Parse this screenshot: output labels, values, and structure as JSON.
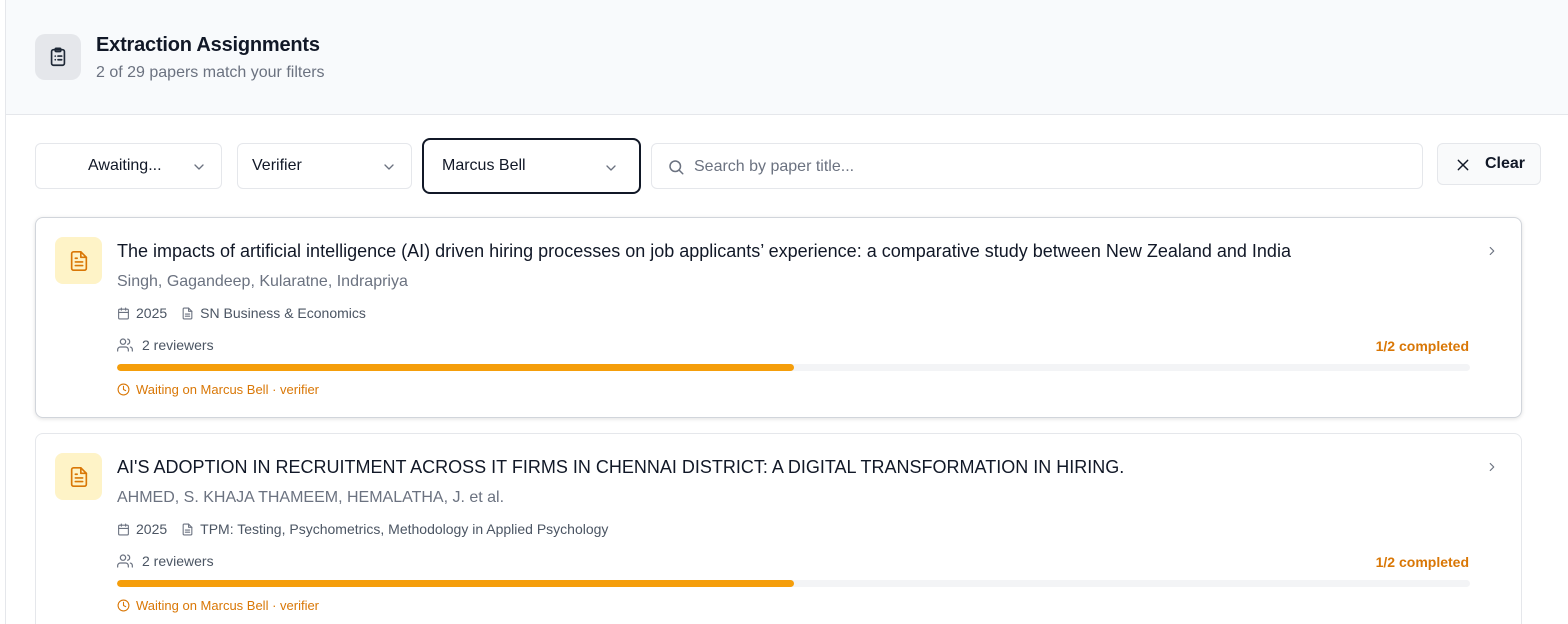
{
  "header": {
    "title": "Extraction Assignments",
    "subtitle": "2 of 29 papers match your filters",
    "icon": "clipboard-list-icon"
  },
  "filters": {
    "status_value": "Awaiting...",
    "role_value": "Verifier",
    "person_value": "Marcus Bell",
    "search_placeholder": "Search by paper title...",
    "search_value": "",
    "clear_label": "Clear"
  },
  "papers": [
    {
      "title": "The impacts of artificial intelligence (AI) driven hiring processes on job applicants’ experience: a comparative study between New Zealand and India",
      "authors": "Singh, Gagandeep, Kularatne, Indrapriya",
      "year": "2025",
      "journal": "SN Business & Economics",
      "reviewers": "2 reviewers",
      "completed": "1/2 completed",
      "progress": 0.5,
      "waiting": "Waiting on Marcus Bell · verifier"
    },
    {
      "title": "AI'S ADOPTION IN RECRUITMENT ACROSS IT FIRMS IN CHENNAI DISTRICT: A DIGITAL TRANSFORMATION IN HIRING.",
      "authors": "AHMED, S. KHAJA THAMEEM, HEMALATHA, J. et al.",
      "year": "2025",
      "journal": "TPM: Testing, Psychometrics, Methodology in Applied Psychology",
      "reviewers": "2 reviewers",
      "completed": "1/2 completed",
      "progress": 0.5,
      "waiting": "Waiting on Marcus Bell · verifier"
    }
  ],
  "colors": {
    "accent": "#f59e0b",
    "accent_text": "#d97706",
    "icon_bg": "#fef3c7"
  }
}
